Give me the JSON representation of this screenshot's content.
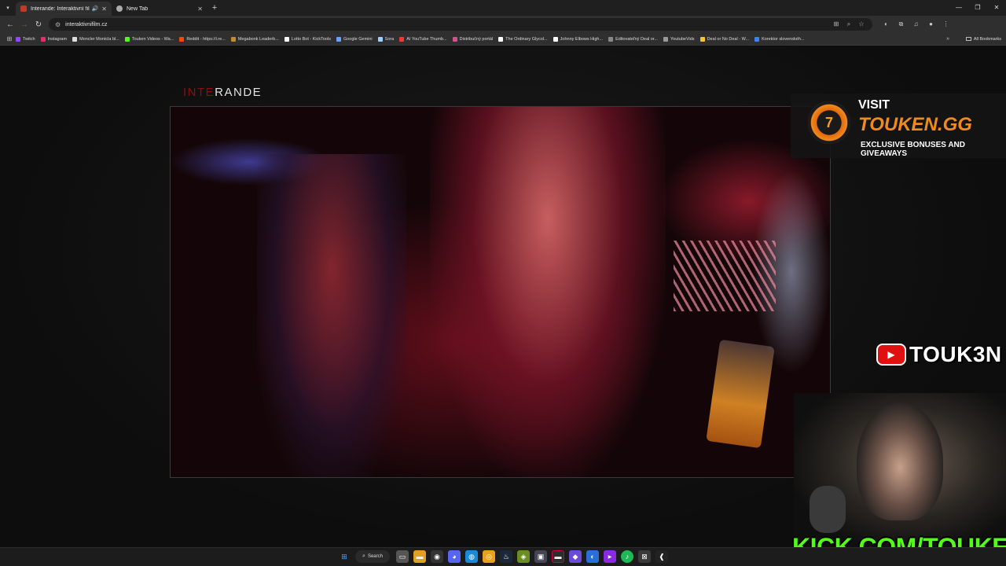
{
  "browser": {
    "tabs": [
      {
        "label": "Interande: Interaktivní film",
        "active": true,
        "audio": true,
        "favicon_color": "#c0392b"
      },
      {
        "label": "New Tab",
        "active": false,
        "audio": false,
        "favicon_color": "#aaaaaa"
      }
    ],
    "url": "interaktivnifilm.cz",
    "bookmarks": [
      {
        "label": "Twitch",
        "color": "#9146ff"
      },
      {
        "label": "Instagram",
        "color": "#e1306c"
      },
      {
        "label": "Moncler Montcla bl...",
        "color": "#dddddd"
      },
      {
        "label": "Touken Videos - Wa...",
        "color": "#53fc18"
      },
      {
        "label": "Reddit - https://i.re...",
        "color": "#ff4500"
      },
      {
        "label": "Megabonk Leaderb...",
        "color": "#c58b2a"
      },
      {
        "label": "Lotto Bot - KickTools",
        "color": "#ffffff"
      },
      {
        "label": "Google Gemini",
        "color": "#6aa0ff"
      },
      {
        "label": "Sora",
        "color": "#9ad0ff"
      },
      {
        "label": "AI YouTube Thumb...",
        "color": "#ff3333"
      },
      {
        "label": "Distribučný portál",
        "color": "#d05090"
      },
      {
        "label": "The Ordinary Glycol...",
        "color": "#ffffff"
      },
      {
        "label": "Johnny Elbows High...",
        "color": "#ffffff"
      },
      {
        "label": "Editovateľný Deal or...",
        "color": "#888888"
      },
      {
        "label": "YoutubeVids",
        "color": "#999999"
      },
      {
        "label": "Deal or No Deal - W...",
        "color": "#f4c430"
      },
      {
        "label": "Korektor slovenskéh...",
        "color": "#3b82f6"
      }
    ],
    "all_bookmarks_label": "All Bookmarks"
  },
  "page": {
    "logo_part1": "INTE",
    "logo_part2": "RANDE"
  },
  "overlays": {
    "promo_visit": "VISIT",
    "promo_site": "TOUKEN.GG",
    "promo_tagline": "EXCLUSIVE BONUSES AND GIVEAWAYS",
    "youtube_handle": "TOUK3N",
    "kick_url": "KICK.COM/TOUKEN"
  },
  "taskbar": {
    "search_label": "Search"
  },
  "colors": {
    "kick_green": "#53fc18",
    "touken_orange": "#f08a1e",
    "logo_red": "#8a1010"
  }
}
